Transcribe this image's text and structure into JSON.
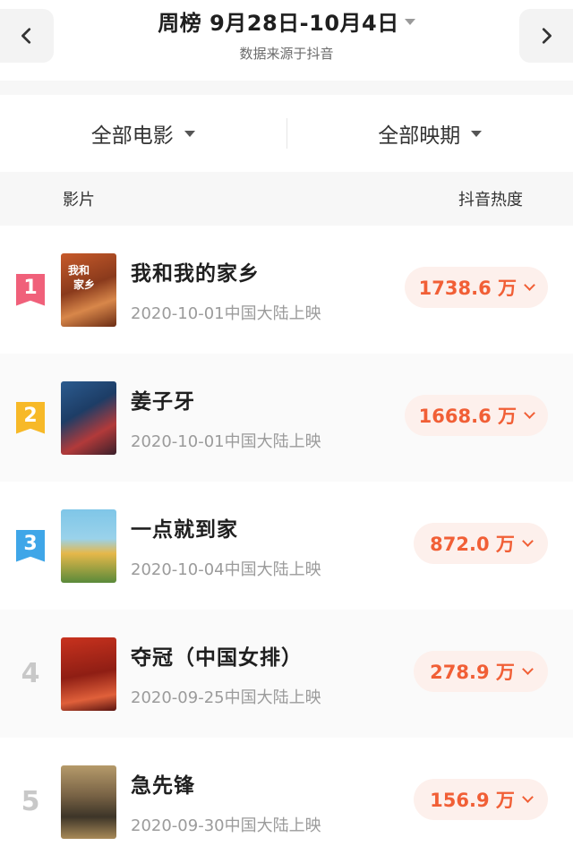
{
  "header": {
    "title": "周榜 9月28日-10月4日",
    "subtitle": "数据来源于抖音"
  },
  "filters": [
    {
      "label": "全部电影"
    },
    {
      "label": "全部映期"
    }
  ],
  "table_head": {
    "film_col": "影片",
    "heat_col": "抖音热度"
  },
  "rank_colors": {
    "1": "#f0607a",
    "2": "#f7b928",
    "3": "#3fa6e8"
  },
  "accent_color": "#f15f36",
  "films": [
    {
      "rank": "1",
      "title": "我和我的家乡",
      "date": "2020-10-01中国大陆上映",
      "heat": "1738.6 万"
    },
    {
      "rank": "2",
      "title": "姜子牙",
      "date": "2020-10-01中国大陆上映",
      "heat": "1668.6 万"
    },
    {
      "rank": "3",
      "title": "一点就到家",
      "date": "2020-10-04中国大陆上映",
      "heat": "872.0 万"
    },
    {
      "rank": "4",
      "title": "夺冠（中国女排）",
      "date": "2020-09-25中国大陆上映",
      "heat": "278.9 万"
    },
    {
      "rank": "5",
      "title": "急先锋",
      "date": "2020-09-30中国大陆上映",
      "heat": "156.9 万"
    }
  ]
}
